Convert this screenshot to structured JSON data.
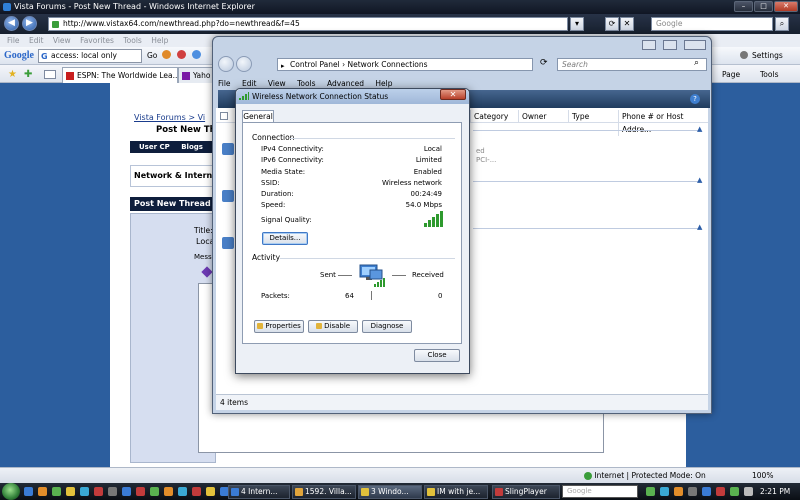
{
  "ie": {
    "title": "Vista Forums - Post New Thread - Windows Internet Explorer",
    "url": "http://www.vistax64.com/newthread.php?do=newthread&f=45",
    "search_placeholder": "Google",
    "menu": [
      "File",
      "Edit",
      "View",
      "Favorites",
      "Tools",
      "Help"
    ],
    "google_toolbar": {
      "logo": "Google",
      "query": "access: local only",
      "go": "Go",
      "settings": "Settings"
    },
    "tabs": [
      "ESPN: The Worldwide Lea...",
      "Yaho"
    ],
    "command_page": "Page",
    "command_tools": "Tools",
    "status_zone": "Internet | Protected Mode: On",
    "zoom": "100%"
  },
  "forum": {
    "breadcrumb": "Vista Forums > Vi",
    "title": "Post New Th",
    "bar_items": [
      "User CP",
      "Blogs"
    ],
    "net_box": "Network & Intern",
    "post_bar": "Post New Thread",
    "title_label": "Title:",
    "title_value": "Loca",
    "message_label": "Mess"
  },
  "control_panel": {
    "breadcrumb": [
      "Control Panel",
      "Network Connections"
    ],
    "search_placeholder": "Search",
    "menu": [
      "File",
      "Edit",
      "View",
      "Tools",
      "Advanced",
      "Help"
    ],
    "columns": [
      "Category",
      "Owner",
      "Type",
      "Phone # or Host Addre..."
    ],
    "partial_text_1": "ed",
    "partial_text_2": "PCI-...",
    "status": "4 items"
  },
  "dialog": {
    "title": "Wireless Network Connection Status",
    "tab": "General",
    "connection_title": "Connection",
    "connection": [
      {
        "label": "IPv4 Connectivity:",
        "value": "Local"
      },
      {
        "label": "IPv6 Connectivity:",
        "value": "Limited"
      },
      {
        "label": "Media State:",
        "value": "Enabled"
      },
      {
        "label": "SSID:",
        "value": "Wireless network"
      },
      {
        "label": "Duration:",
        "value": "00:24:49"
      },
      {
        "label": "Speed:",
        "value": "54.0 Mbps"
      }
    ],
    "signal_label": "Signal Quality:",
    "signal_bars": 5,
    "details_button": "Details...",
    "activity_title": "Activity",
    "sent_label": "Sent",
    "received_label": "Received",
    "packets_label": "Packets:",
    "packets_sent": "64",
    "packets_received": "0",
    "properties_button": "Properties",
    "disable_button": "Disable",
    "diagnose_button": "Diagnose",
    "close_button": "Close"
  },
  "taskbar": {
    "buttons": [
      "4 Intern...",
      "1592. Villa...",
      "3 Windo...",
      "IM with je...",
      "SlingPlayer"
    ],
    "search_placeholder": "Google",
    "clock": "2:21 PM"
  },
  "colors": {
    "accent": "#2c5e9e",
    "forum_dark": "#0e1e3c",
    "signal_green": "#2e9a2e"
  }
}
